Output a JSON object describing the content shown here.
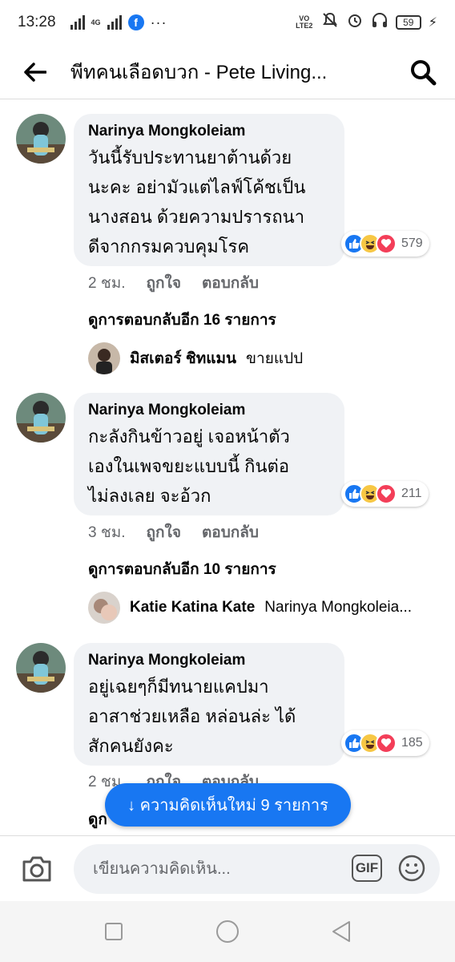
{
  "status_bar": {
    "time": "13:28",
    "network": "4G",
    "volte": "VO LTE2",
    "battery": "59"
  },
  "header": {
    "title": "พีทคนเลือดบวก - Pete Living..."
  },
  "comments": [
    {
      "author": "Narinya Mongkoleiam",
      "text": "วันนี้รับประทานยาต้านด้วย\nนะคะ อย่ามัวแต่ไลฟ์โค้ชเป็น\nนางสอน ด้วยความปรารถนา\nดีจากกรมควบคุมโรค",
      "reaction_count": "579",
      "time": "2 ชม.",
      "like_label": "ถูกใจ",
      "reply_label": "ตอบกลับ",
      "more_replies": "ดูการตอบกลับอีก 16 รายการ",
      "reply_preview": {
        "name": "มิสเตอร์ ชิทแมน",
        "text": "ขายแปป"
      }
    },
    {
      "author": "Narinya Mongkoleiam",
      "text": "กะลังกินข้าวอยู่ เจอหน้าตัว\nเองในเพจขยะแบบนี้ กินต่อ\nไม่ลงเลย จะอ้วก",
      "reaction_count": "211",
      "time": "3 ชม.",
      "like_label": "ถูกใจ",
      "reply_label": "ตอบกลับ",
      "more_replies": "ดูการตอบกลับอีก 10 รายการ",
      "reply_preview": {
        "name": "Katie Katina Kate",
        "text": "Narinya Mongkoleia..."
      }
    },
    {
      "author": "Narinya Mongkoleiam",
      "text": "อยู่เฉยๆก็มีทนายแคปมา\nอาสาช่วยเหลือ หล่อนล่ะ ได้\nสักคนยังคะ",
      "reaction_count": "185",
      "time": "2 ชม.",
      "like_label": "ถูกใจ",
      "reply_label": "ตอบกลับ",
      "more_replies": "ดูก"
    }
  ],
  "new_comments_pill": "↓ ความคิดเห็นใหม่ 9 รายการ",
  "composer": {
    "placeholder": "เขียนความคิดเห็น...",
    "gif_label": "GIF"
  },
  "colors": {
    "accent": "#1877f2",
    "bubble": "#f0f2f5",
    "muted_text": "#65676b",
    "love": "#f33e58",
    "haha": "#f7c744"
  }
}
